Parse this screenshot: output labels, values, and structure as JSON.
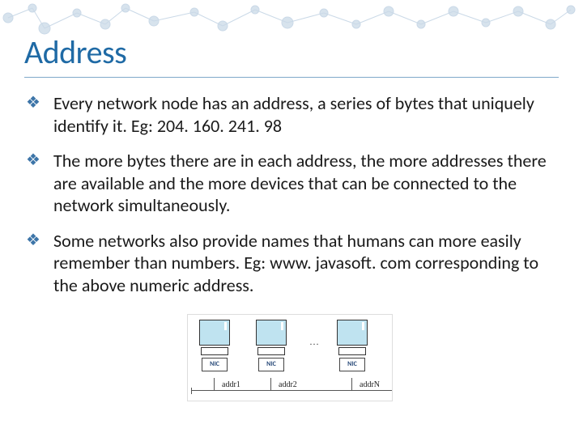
{
  "title": "Address",
  "bullets": [
    "Every network node has an address, a series of bytes that uniquely identify it. Eg: 204. 160. 241. 98",
    "The more bytes there are in each address, the more addresses there are available and the more devices that can be connected to the network simultaneously.",
    "Some networks also provide names that humans can more easily remember than numbers. Eg: www. javasoft. com corresponding to the above numeric address."
  ],
  "figure": {
    "nic_label": "NIC",
    "addr_labels": [
      "addr1",
      "addr2",
      "addrN"
    ],
    "ellipsis": "…"
  }
}
